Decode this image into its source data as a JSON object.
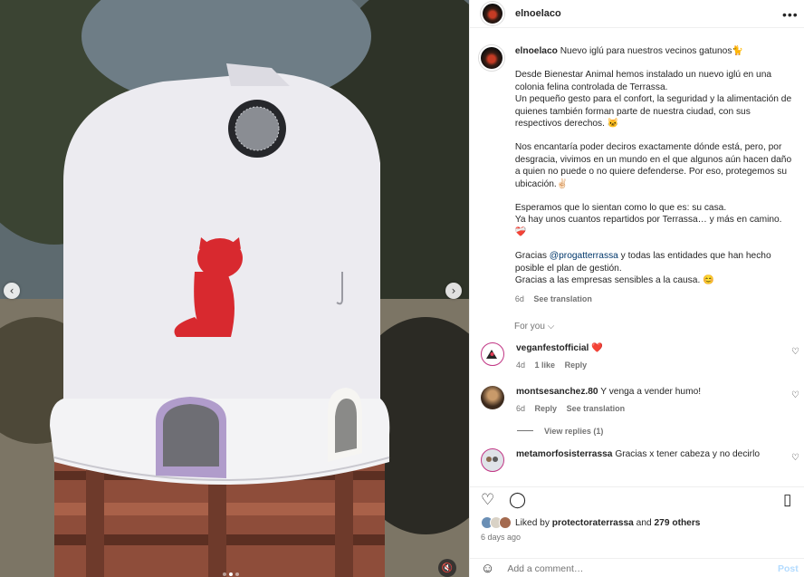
{
  "post": {
    "username": "elnoelaco",
    "caption_username": "elnoelaco",
    "caption_paragraphs": [
      "Nuevo iglú para nuestros vecinos gatunos🐈",
      "Desde Bienestar Animal hemos instalado un nuevo iglú en una colonia felina controlada de Terrassa.\nUn pequeño gesto para el confort, la seguridad y la alimentación de quienes también forman parte de nuestra ciudad, con sus respectivos derechos. 🐱",
      "Nos encantaría poder deciros exactamente dónde está, pero, por desgracia, vivimos en un mundo en el que algunos aún hacen daño a quien no puede o no quiere defenderse. Por eso, protegemos su ubicación.✌🏻",
      "Esperamos que lo sientan como lo que es: su casa.\nYa hay unos cuantos repartidos por Terrassa… y más en camino. ❤️‍🩹"
    ],
    "caption_last_pre": "Gracias ",
    "caption_mention": "@progatterrassa",
    "caption_last_post": " y todas las entidades que han hecho posible el plan de gestión.\nGracias a las empresas sensibles a la causa. 😊",
    "caption_age": "6d",
    "see_translation": "See translation",
    "more_icon": "more-options-icon"
  },
  "for_you": "For you",
  "comments": [
    {
      "user": "veganfestofficial",
      "text": "❤️",
      "age": "4d",
      "likes": "1 like",
      "reply": "Reply",
      "avatar_color": "#ffffff"
    },
    {
      "user": "montsesanchez.80",
      "text": "Y venga a vender humo!",
      "age": "6d",
      "reply": "Reply",
      "translation": "See translation",
      "view_replies": "View replies (1)",
      "avatar_color": "#6b4a2e"
    },
    {
      "user": "metamorfosisterrassa",
      "text": "Gracias x tener cabeza y no decirlo",
      "avatar_color": "#dfe3e8"
    }
  ],
  "actions": {
    "liked_by_prefix": "Liked by ",
    "liked_by_user": "protectoraterrassa",
    "liked_by_and": " and ",
    "liked_by_others": "279 others",
    "date": "6 days ago",
    "add_comment_placeholder": "Add a comment…",
    "post_label": "Post"
  },
  "media": {
    "prev_label": "‹",
    "next_label": "›",
    "carousel_total": 3,
    "carousel_active": 1
  },
  "colors": {
    "link": "#00376b",
    "muted": "#737373",
    "post_disabled": "#b3dbff",
    "heart": "#ff3040",
    "igloo_cat": "#d8292f"
  }
}
